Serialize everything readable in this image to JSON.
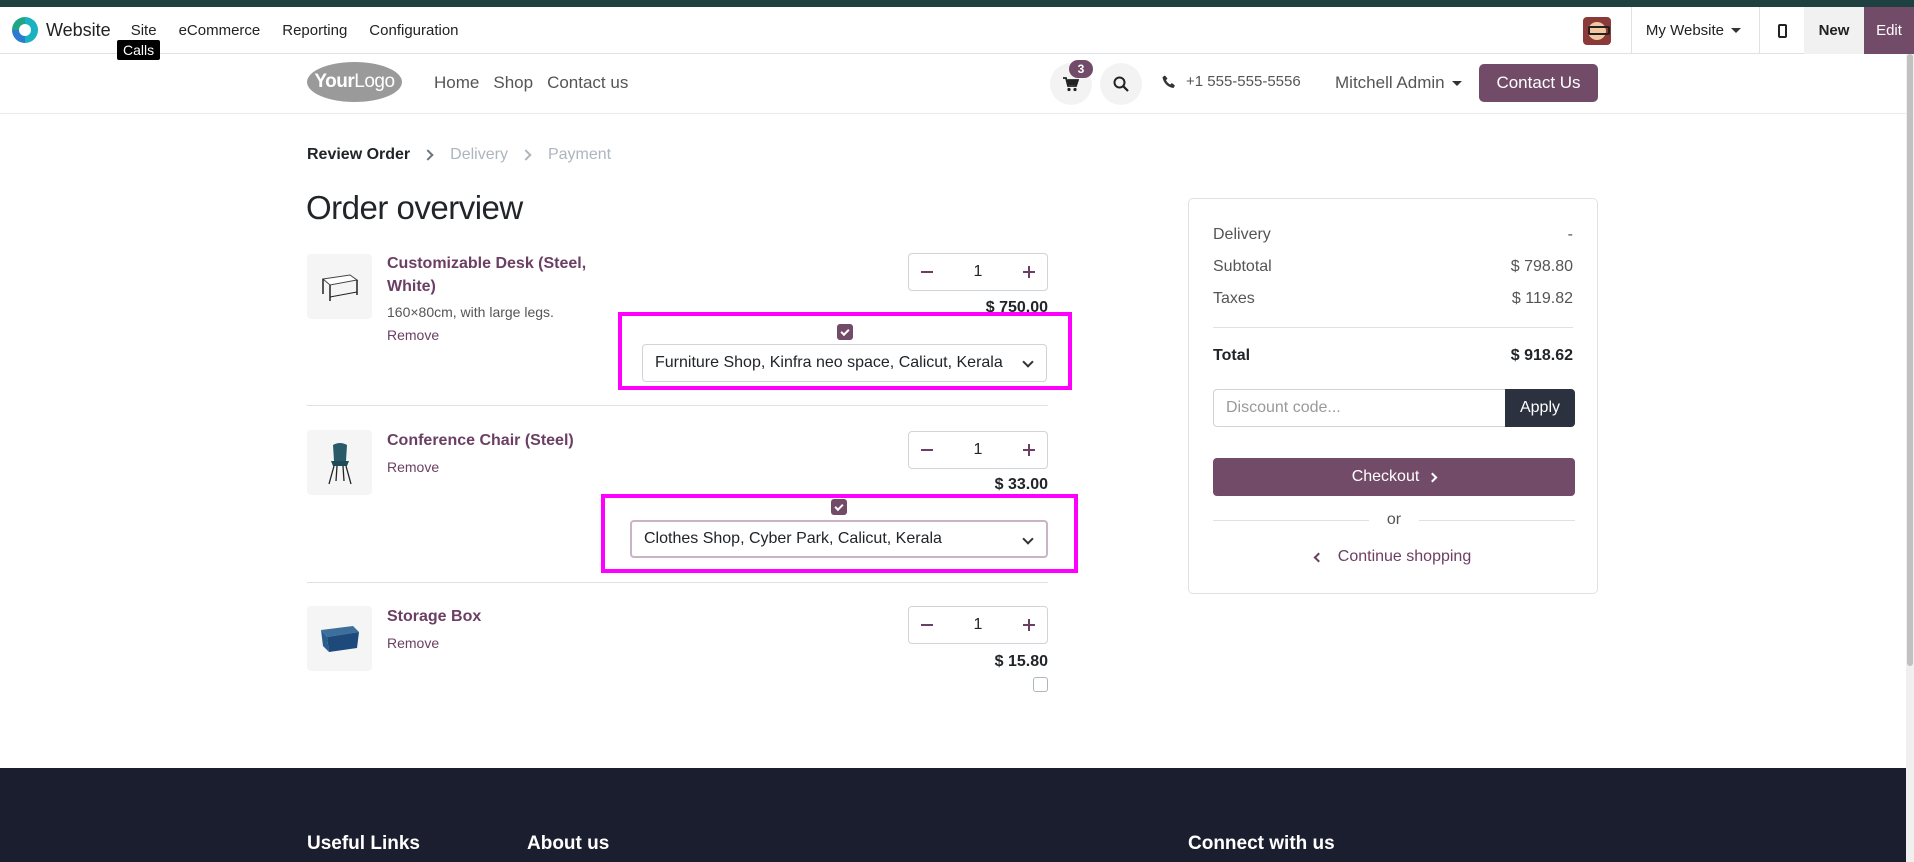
{
  "admin_bar": {
    "app_name": "Website",
    "menu": [
      "Site",
      "eCommerce",
      "Reporting",
      "Configuration"
    ],
    "tooltip": "Calls",
    "website_selector": "My Website",
    "new_label": "New",
    "edit_label": "Edit"
  },
  "site_header": {
    "logo_bold": "Your",
    "logo_rest": "Logo",
    "nav": [
      "Home",
      "Shop",
      "Contact us"
    ],
    "cart_count": "3",
    "phone": "+1 555-555-5556",
    "user": "Mitchell Admin",
    "contact_button": "Contact Us"
  },
  "steps": {
    "active": "Review Order",
    "delivery": "Delivery",
    "payment": "Payment"
  },
  "page_title": "Order overview",
  "order_lines": [
    {
      "name_line1": "Customizable Desk (Steel,",
      "name_line2": "White)",
      "description": "160×80cm, with large legs.",
      "remove": "Remove",
      "quantity": "1",
      "price": "$ 750.00",
      "checked": true,
      "shop": "Furniture Shop, Kinfra neo space, Calicut, Kerala"
    },
    {
      "name_line1": "Conference Chair (Steel)",
      "remove": "Remove",
      "quantity": "1",
      "price": "$ 33.00",
      "checked": true,
      "shop": "Clothes Shop, Cyber Park, Calicut, Kerala"
    },
    {
      "name_line1": "Storage Box",
      "remove": "Remove",
      "quantity": "1",
      "price": "$ 15.80",
      "checked": false
    }
  ],
  "summary": {
    "delivery_label": "Delivery",
    "delivery_value": "-",
    "subtotal_label": "Subtotal",
    "subtotal_value": "$ 798.80",
    "taxes_label": "Taxes",
    "taxes_value": "$ 119.82",
    "total_label": "Total",
    "total_value": "$ 918.62",
    "discount_placeholder": "Discount code...",
    "apply_label": "Apply",
    "checkout_label": "Checkout",
    "or_label": "or",
    "continue_label": "Continue shopping"
  },
  "footer": {
    "useful_links": "Useful Links",
    "about_us": "About us",
    "connect": "Connect with us"
  },
  "colors": {
    "brand": "#714b67",
    "highlight": "#ff00ff",
    "footer_bg": "#1b1e2e"
  }
}
